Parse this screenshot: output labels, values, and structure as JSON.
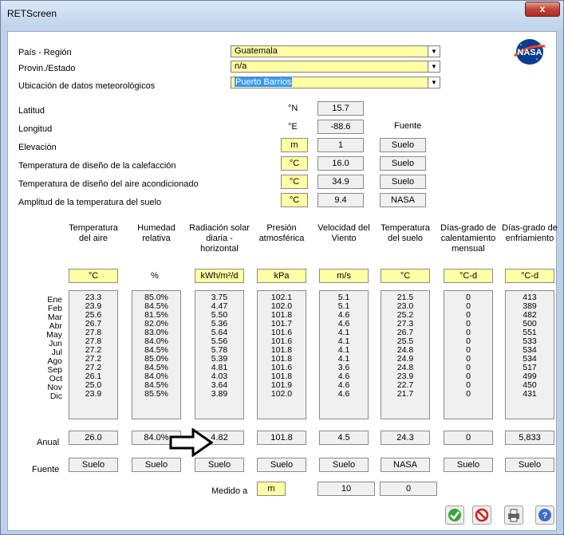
{
  "window": {
    "title": "RETScreen",
    "close_label": "x"
  },
  "location": {
    "country_label": "País - Región",
    "country_value": "Guatemala",
    "state_label": "Provin./Estado",
    "state_value": "n/a",
    "station_label": "Ubicación de datos meteorológicos",
    "station_value": "Puerto Barrios"
  },
  "site": {
    "source_header": "Fuente",
    "rows": [
      {
        "label": "Latitud",
        "unit": "°N",
        "value": "15.7",
        "source": ""
      },
      {
        "label": "Longitud",
        "unit": "°E",
        "value": "-88.6",
        "source": ""
      },
      {
        "label": "Elevación",
        "unit": "m",
        "value": "1",
        "source": "Suelo"
      },
      {
        "label": "Temperatura de diseño de la calefacción",
        "unit": "°C",
        "value": "16.0",
        "source": "Suelo"
      },
      {
        "label": "Temperatura de diseño del aire acondicionado",
        "unit": "°C",
        "value": "34.9",
        "source": "Suelo"
      },
      {
        "label": "Amplitud de la temperatura del suelo",
        "unit": "°C",
        "value": "9.4",
        "source": "NASA"
      }
    ]
  },
  "table": {
    "headers": [
      "Temperatura del aire",
      "Humedad relativa",
      "Radiación solar diaria - horizontal",
      "Presión atmosférica",
      "Velocidad del Viento",
      "Temperatura del suelo",
      "Días-grado de calentamiento mensual",
      "Días-grado de enfriamiento"
    ],
    "units": [
      "°C",
      "%",
      "kWh/m²/d",
      "kPa",
      "m/s",
      "°C",
      "°C-d",
      "°C-d"
    ],
    "months": [
      "Ene",
      "Feb",
      "Mar",
      "Abr",
      "May",
      "Jun",
      "Jul",
      "Ago",
      "Sep",
      "Oct",
      "Nov",
      "Dic"
    ],
    "columns": [
      [
        "23.3",
        "23.9",
        "25.6",
        "26.7",
        "27.8",
        "27.8",
        "27.2",
        "27.2",
        "27.2",
        "26.1",
        "25.0",
        "23.9"
      ],
      [
        "85.0%",
        "84.5%",
        "81.5%",
        "82.0%",
        "83.0%",
        "84.0%",
        "84.5%",
        "85.0%",
        "84.5%",
        "84.0%",
        "84.5%",
        "85.5%"
      ],
      [
        "3.75",
        "4.47",
        "5.50",
        "5.36",
        "5.64",
        "5.56",
        "5.78",
        "5.39",
        "4.81",
        "4.03",
        "3.64",
        "3.89"
      ],
      [
        "102.1",
        "102.0",
        "101.8",
        "101.7",
        "101.6",
        "101.6",
        "101.8",
        "101.8",
        "101.6",
        "101.8",
        "101.9",
        "102.0"
      ],
      [
        "5.1",
        "5.1",
        "4.6",
        "4.6",
        "4.1",
        "4.1",
        "4.1",
        "4.1",
        "3.6",
        "4.6",
        "4.6",
        "4.6"
      ],
      [
        "21.5",
        "23.0",
        "25.2",
        "27.3",
        "26.7",
        "25.5",
        "24.8",
        "24.9",
        "24.8",
        "23.9",
        "22.7",
        "21.7"
      ],
      [
        "0",
        "0",
        "0",
        "0",
        "0",
        "0",
        "0",
        "0",
        "0",
        "0",
        "0",
        "0"
      ],
      [
        "413",
        "389",
        "482",
        "500",
        "551",
        "533",
        "534",
        "534",
        "517",
        "499",
        "450",
        "431"
      ]
    ],
    "annual_label": "Anual",
    "annual": [
      "26.0",
      "84.0%",
      "4.82",
      "101.8",
      "4.5",
      "24.3",
      "0",
      "5,833"
    ],
    "source_label": "Fuente",
    "sources": [
      "Suelo",
      "Suelo",
      "Suelo",
      "Suelo",
      "Suelo",
      "NASA",
      "Suelo",
      "Suelo"
    ]
  },
  "measured": {
    "label": "Medido a",
    "unit": "m",
    "wind_height": "10",
    "soil_depth": "0"
  },
  "nasa_logo": "NASA",
  "icons": [
    "ok-icon",
    "cancel-icon",
    "print-icon",
    "help-icon"
  ]
}
